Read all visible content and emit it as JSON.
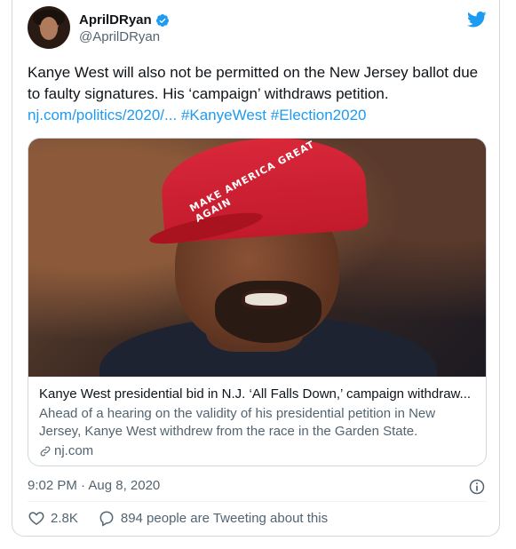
{
  "author": {
    "display_name": "AprilDRyan",
    "handle": "@AprilDRyan",
    "verified": true
  },
  "tweet": {
    "text_plain": "Kanye West will also not be permitted on the New Jersey ballot due to faulty signatures. His ‘campaign’ withdraws petition. ",
    "link_url_text": "nj.com/politics/2020/...",
    "hashtag_1": "#KanyeWest",
    "hashtag_2": "#Election2020"
  },
  "card": {
    "image_cap_text": "MAKE AMERICA GREAT AGAIN",
    "title": "Kanye West presidential bid in N.J. ‘All Falls Down,’ campaign withdraw...",
    "description": "Ahead of a hearing on the validity of his presidential petition in New Jersey, Kanye West withdrew from the race in the Garden State.",
    "domain": "nj.com"
  },
  "meta": {
    "timestamp": "9:02 PM · Aug 8, 2020"
  },
  "actions": {
    "likes": "2.8K",
    "tweeting_about": "894 people are Tweeting about this"
  },
  "icons": {
    "brand": "twitter-bird-icon",
    "verified": "verified-badge-icon",
    "info": "info-icon",
    "like": "heart-icon",
    "reply": "comment-icon",
    "link": "link-icon"
  },
  "colors": {
    "accent": "#1d9bf0",
    "text_primary": "#0f1419",
    "text_secondary": "#536471",
    "border": "#cfd9de"
  }
}
